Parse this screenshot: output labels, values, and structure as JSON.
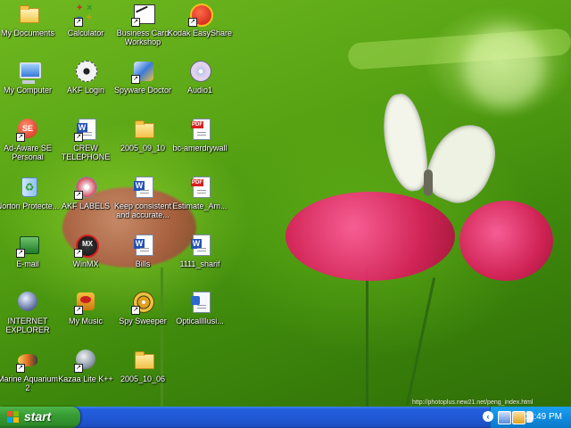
{
  "desktop": {
    "icons": [
      {
        "label": "My Documents",
        "icon": "folder-docs-icon"
      },
      {
        "label": "My Computer",
        "icon": "computer-icon"
      },
      {
        "label": "Ad-Aware SE Personal",
        "icon": "adaware-icon"
      },
      {
        "label": "Norton Protecte...",
        "icon": "recycle-bin-icon"
      },
      {
        "label": "E-mail",
        "icon": "email-icon"
      },
      {
        "label": "INTERNET EXPLORER",
        "icon": "globe-icon"
      },
      {
        "label": "Marine Aquarium 2",
        "icon": "fish-icon"
      },
      {
        "label": "Calculator",
        "icon": "calculator-icon"
      },
      {
        "label": "AKF Login",
        "icon": "flower-icon"
      },
      {
        "label": "CREW TELEPHONE",
        "icon": "word-doc-icon"
      },
      {
        "label": "AKF LABELS",
        "icon": "disc-icon"
      },
      {
        "label": "WinMX",
        "icon": "winmx-icon"
      },
      {
        "label": "My Music",
        "icon": "music-icon"
      },
      {
        "label": "Kazaa Lite K++",
        "icon": "kazaa-icon"
      },
      {
        "label": "Business Card Workshop",
        "icon": "business-card-icon"
      },
      {
        "label": "Spyware Doctor",
        "icon": "spyware-doctor-icon"
      },
      {
        "label": "2005_09_10",
        "icon": "folder-icon"
      },
      {
        "label": "Keep consistent and accurate...",
        "icon": "word-doc-icon"
      },
      {
        "label": "Bills",
        "icon": "word-doc-icon"
      },
      {
        "label": "Spy Sweeper",
        "icon": "spy-sweeper-icon"
      },
      {
        "label": "2005_10_06",
        "icon": "folder-icon"
      },
      {
        "label": "Kodak EasyShare",
        "icon": "kodak-icon"
      },
      {
        "label": "Audio1",
        "icon": "audio-cd-icon"
      },
      {
        "label": "bc-amerdrywall",
        "icon": "pdf-icon"
      },
      {
        "label": "Estimate_Am...",
        "icon": "pdf-icon"
      },
      {
        "label": "1111_sharif",
        "icon": "word-doc-icon"
      },
      {
        "label": "OpticalIllusi...",
        "icon": "optical-illusion-icon"
      }
    ],
    "watermark": "http://photoplus.new21.net/peng_index.html"
  },
  "taskbar": {
    "start_label": "start",
    "clock": "11:49 PM",
    "tray_icons": [
      "network-icon",
      "antivirus-icon",
      "speaker-icon"
    ],
    "colors": {
      "taskbar": "#2058d6",
      "start": "#389c34",
      "tray": "#0f8ce0"
    }
  }
}
